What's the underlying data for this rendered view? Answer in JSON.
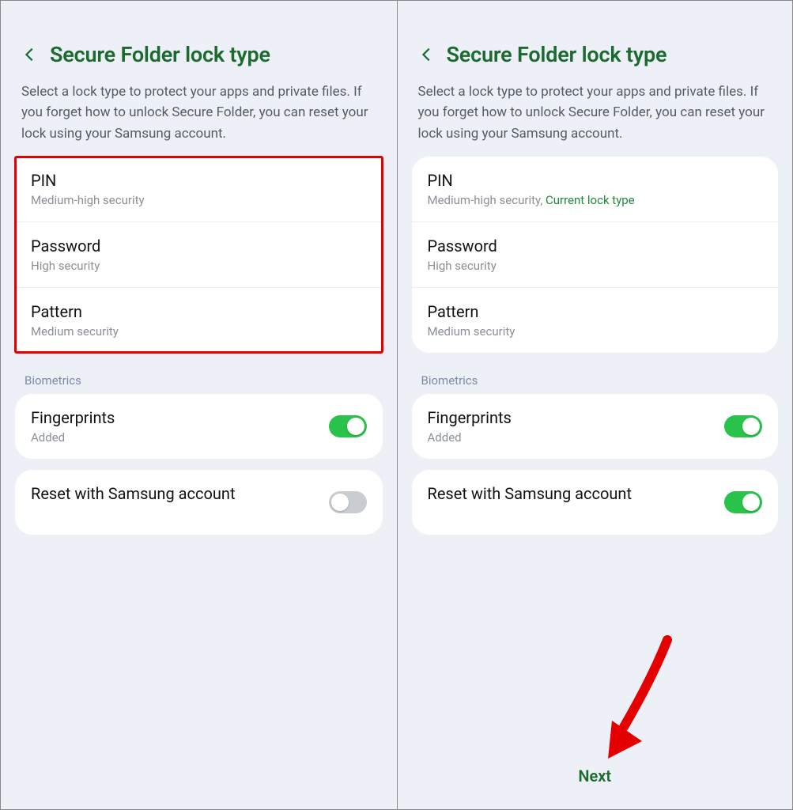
{
  "screens": {
    "left": {
      "title": "Secure Folder lock type",
      "description": "Select a lock type to protect your apps and private files. If you forget how to unlock Secure Folder, you can reset your lock using your Samsung account.",
      "lock_options": [
        {
          "label": "PIN",
          "sub": "Medium-high security",
          "current": ""
        },
        {
          "label": "Password",
          "sub": "High security",
          "current": ""
        },
        {
          "label": "Pattern",
          "sub": "Medium security",
          "current": ""
        }
      ],
      "biometrics_label": "Biometrics",
      "fingerprints": {
        "label": "Fingerprints",
        "sub": "Added",
        "on": true
      },
      "reset": {
        "label": "Reset with Samsung account",
        "on": false
      }
    },
    "right": {
      "title": "Secure Folder lock type",
      "description": "Select a lock type to protect your apps and private files. If you forget how to unlock Secure Folder, you can reset your lock using your Samsung account.",
      "lock_options": [
        {
          "label": "PIN",
          "sub": "Medium-high security, ",
          "current": "Current lock type"
        },
        {
          "label": "Password",
          "sub": "High security",
          "current": ""
        },
        {
          "label": "Pattern",
          "sub": "Medium security",
          "current": ""
        }
      ],
      "biometrics_label": "Biometrics",
      "fingerprints": {
        "label": "Fingerprints",
        "sub": "Added",
        "on": true
      },
      "reset": {
        "label": "Reset with Samsung account",
        "on": true
      },
      "next_label": "Next"
    }
  }
}
